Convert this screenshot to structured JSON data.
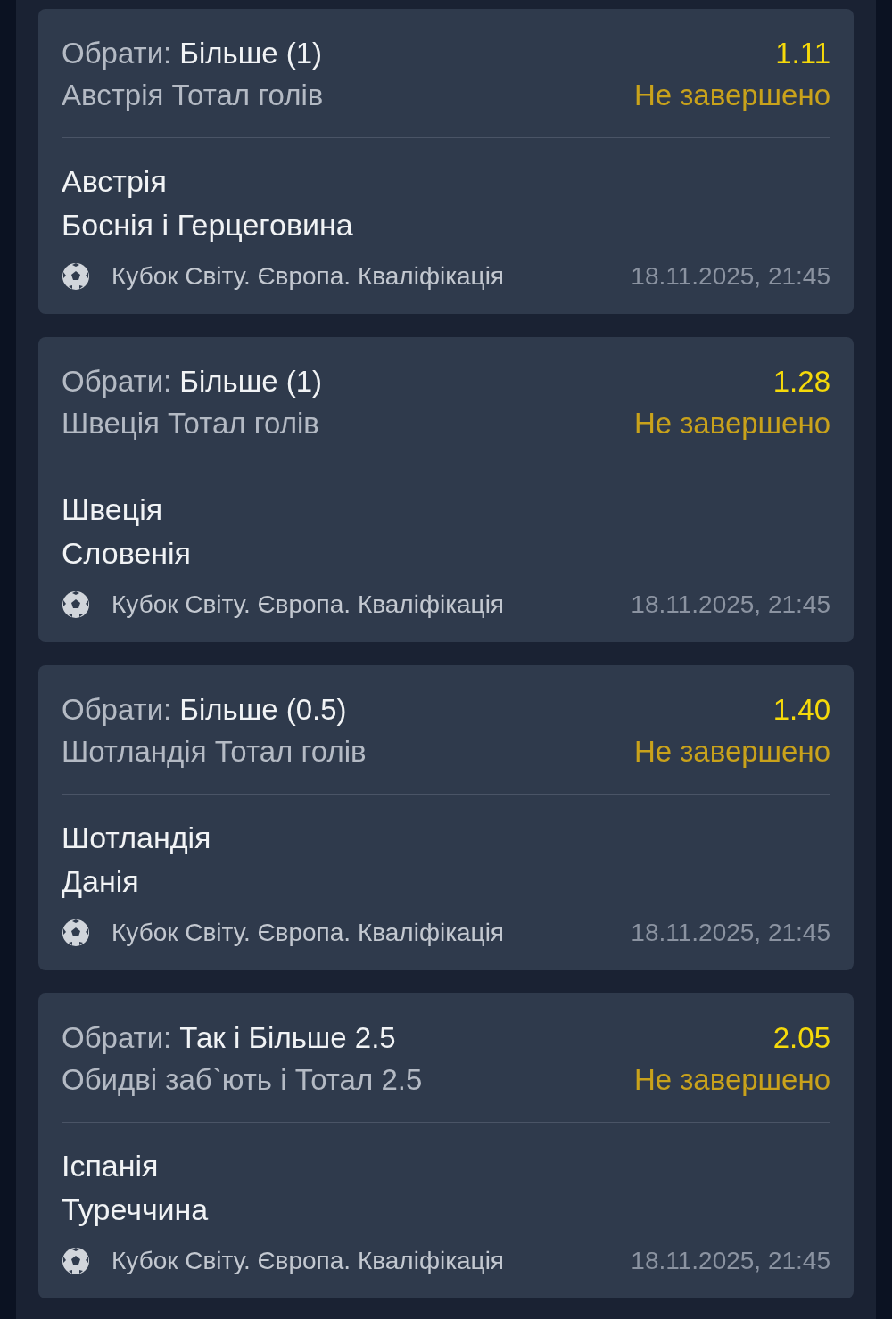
{
  "bets": [
    {
      "pick_label": "Обрати:",
      "pick": "Більше (1)",
      "market": "Австрія Тотал голів",
      "odds": "1.11",
      "status": "Не завершено",
      "teams": [
        "Австрія",
        "Боснія і Герцеговина"
      ],
      "tournament": "Кубок Світу. Європа. Кваліфікація",
      "datetime": "18.11.2025, 21:45"
    },
    {
      "pick_label": "Обрати:",
      "pick": "Більше (1)",
      "market": "Швеція Тотал голів",
      "odds": "1.28",
      "status": "Не завершено",
      "teams": [
        "Швеція",
        "Словенія"
      ],
      "tournament": "Кубок Світу. Європа. Кваліфікація",
      "datetime": "18.11.2025, 21:45"
    },
    {
      "pick_label": "Обрати:",
      "pick": "Більше (0.5)",
      "market": "Шотландія Тотал голів",
      "odds": "1.40",
      "status": "Не завершено",
      "teams": [
        "Шотландія",
        "Данія"
      ],
      "tournament": "Кубок Світу. Європа. Кваліфікація",
      "datetime": "18.11.2025, 21:45"
    },
    {
      "pick_label": "Обрати:",
      "pick": "Так і Більше 2.5",
      "market": "Обидві заб`ють і Тотал 2.5",
      "odds": "2.05",
      "status": "Не завершено",
      "teams": [
        "Іспанія",
        "Туреччина"
      ],
      "tournament": "Кубок Світу. Європа. Кваліфікація",
      "datetime": "18.11.2025, 21:45"
    }
  ]
}
